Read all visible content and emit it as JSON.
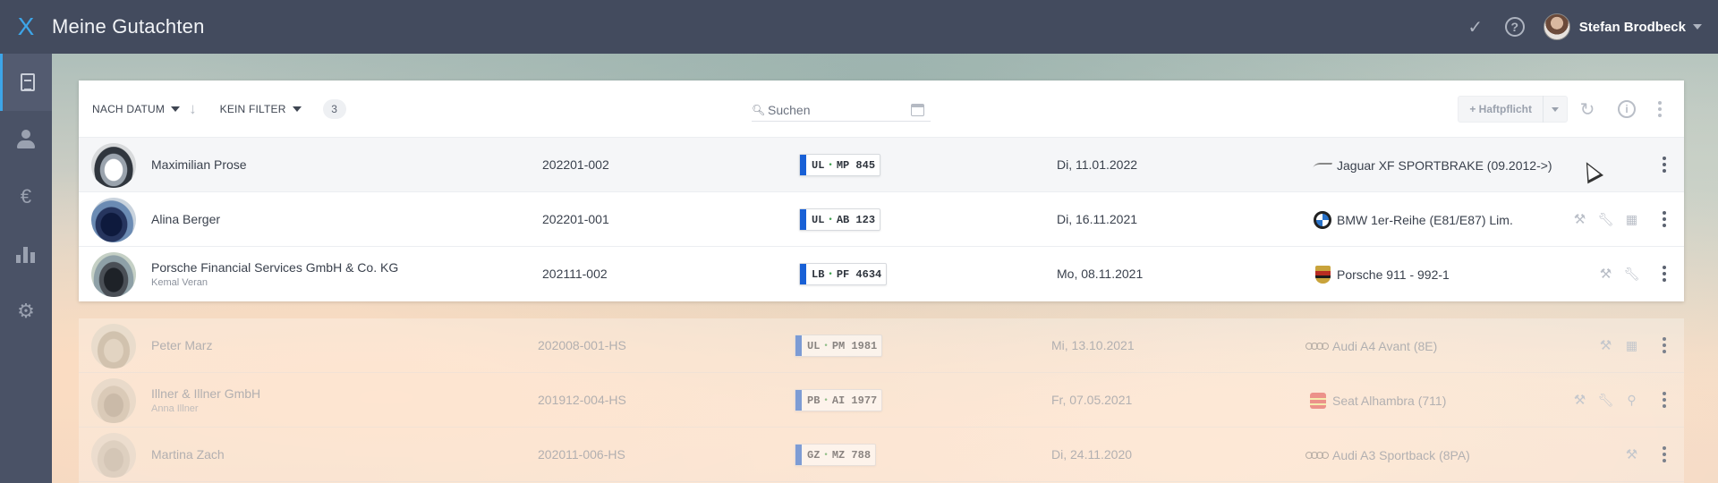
{
  "app": {
    "title": "Meine Gutachten",
    "logo": "X",
    "user_name": "Stefan Brodbeck"
  },
  "topbar": {
    "icons": [
      "check-icon",
      "help-icon",
      "avatar"
    ]
  },
  "sidebar": {
    "items": [
      {
        "icon": "document-icon",
        "active": true
      },
      {
        "icon": "person-icon",
        "active": false
      },
      {
        "icon": "euro-icon",
        "active": false
      },
      {
        "icon": "bar-chart-icon",
        "active": false
      },
      {
        "icon": "gear-icon",
        "active": false
      }
    ]
  },
  "toolbar": {
    "sort_label": "NACH DATUM",
    "filter_label": "KEIN FILTER",
    "count": "3",
    "search_placeholder": "Suchen",
    "haftpflicht_label": "+ Haftpflicht"
  },
  "rows": [
    {
      "name": "Maximilian Prose",
      "sub": "",
      "number": "202201-002",
      "plate_a": "UL",
      "plate_b": "MP 845",
      "date": "Di, 11.01.2022",
      "model": "Jaguar XF SPORTBRAKE (09.2012->)",
      "brand": "jaguar"
    },
    {
      "name": "Alina Berger",
      "sub": "",
      "number": "202201-001",
      "plate_a": "UL",
      "plate_b": "AB 123",
      "date": "Di, 16.11.2021",
      "model": "BMW 1er-Reihe (E81/E87) Lim.",
      "brand": "bmw"
    },
    {
      "name": "Porsche Financial Services GmbH & Co. KG",
      "sub": "Kemal Veran",
      "number": "202111-002",
      "plate_a": "LB",
      "plate_b": "PF 4634",
      "date": "Mo, 08.11.2021",
      "model": "Porsche 911 - 992-1",
      "brand": "porsche"
    }
  ],
  "archived_rows": [
    {
      "name": "Peter Marz",
      "sub": "",
      "number": "202008-001-HS",
      "plate_a": "UL",
      "plate_b": "PM 1981",
      "date": "Mi, 13.10.2021",
      "model": "Audi A4 Avant (8E)",
      "brand": "audi"
    },
    {
      "name": "Illner & Illner GmbH",
      "sub": "Anna Illner",
      "number": "201912-004-HS",
      "plate_a": "PB",
      "plate_b": "AI 1977",
      "date": "Fr, 07.05.2021",
      "model": "Seat Alhambra (711)",
      "brand": "seat"
    },
    {
      "name": "Martina Zach",
      "sub": "",
      "number": "202011-006-HS",
      "plate_a": "GZ",
      "plate_b": "MZ 788",
      "date": "Di, 24.11.2020",
      "model": "Audi A3 Sportback (8PA)",
      "brand": "audi"
    }
  ],
  "colors": {
    "topbar": "#434b5e",
    "sidebar": "#4a5266",
    "accent": "#3da5e8",
    "plate_eu": "#1860d6"
  }
}
